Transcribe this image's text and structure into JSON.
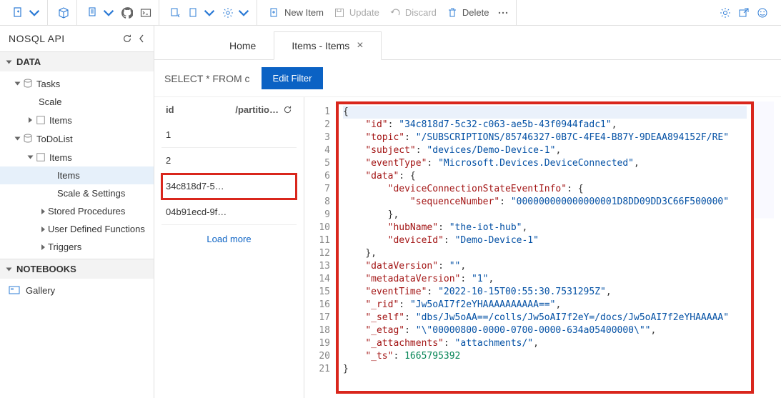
{
  "toolbar": {
    "new_item": "New Item",
    "update": "Update",
    "discard": "Discard",
    "delete": "Delete"
  },
  "sidebar": {
    "title": "NOSQL API",
    "sections": {
      "data": "DATA",
      "notebooks": "NOTEBOOKS"
    },
    "tree": {
      "tasks": "Tasks",
      "scale": "Scale",
      "items_under_tasks": "Items",
      "todolist": "ToDoList",
      "items": "Items",
      "items_child": "Items",
      "scale_settings": "Scale & Settings",
      "stored_procs": "Stored Procedures",
      "udf": "User Defined Functions",
      "triggers": "Triggers"
    },
    "gallery": "Gallery"
  },
  "tabs": {
    "home": "Home",
    "items": "Items - Items"
  },
  "query": {
    "text": "SELECT * FROM c",
    "edit_filter": "Edit Filter"
  },
  "item_list": {
    "col_id": "id",
    "col_partition": "/partitio…",
    "rows": [
      "1",
      "2",
      "34c818d7-5…",
      "04b91ecd-9f…"
    ],
    "selected_index": 2,
    "load_more": "Load more"
  },
  "editor": {
    "line_count": 21,
    "json": {
      "id": "34c818d7-5c32-c063-ae5b-43f0944fadc1",
      "topic": "/SUBSCRIPTIONS/85746327-0B7C-4FE4-B87Y-9DEAA894152F/RE",
      "subject": "devices/Demo-Device-1",
      "eventType": "Microsoft.Devices.DeviceConnected",
      "data_open": "{",
      "deviceConnectionStateEventInfo_open": "{",
      "sequenceNumber": "000000000000000001D8DD09DD3C66F500000",
      "close1": "},",
      "hubName": "the-iot-hub",
      "deviceId": "Demo-Device-1",
      "close2": "},",
      "dataVersion": "",
      "metadataVersion": "1",
      "eventTime": "2022-10-15T00:55:30.7531295Z",
      "_rid": "Jw5oAI7f2eYHAAAAAAAAAA==",
      "_self": "dbs/Jw5oAA==/colls/Jw5oAI7f2eY=/docs/Jw5oAI7f2eYHAAAAA",
      "_etag": "\\\"00000800-0000-0700-0000-634a05400000\\\"",
      "_attachments": "attachments/",
      "_ts": 1665795392
    }
  }
}
